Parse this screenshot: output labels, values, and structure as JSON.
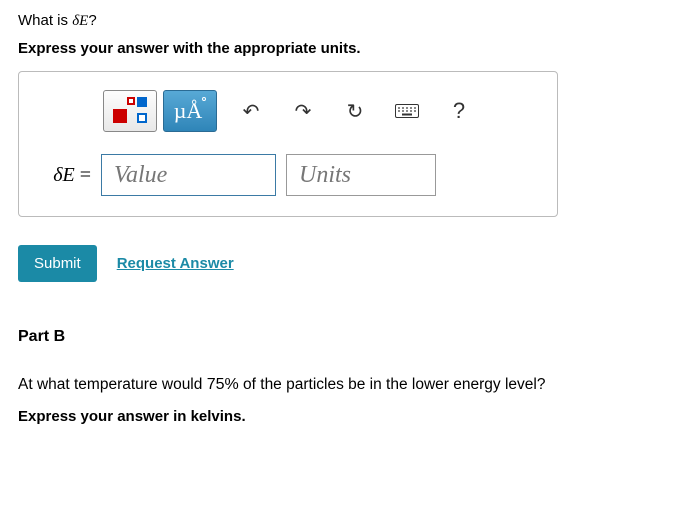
{
  "question": {
    "prefix": "What is ",
    "var": "δE",
    "suffix": "?"
  },
  "instruction": "Express your answer with the appropriate units.",
  "toolbar": {
    "mu_a": "µÅ",
    "undo": "↶",
    "redo": "↷",
    "reset": "↻",
    "help": "?"
  },
  "input": {
    "lhs_var": "δE",
    "lhs_eq": " = ",
    "value_placeholder": "Value",
    "units_placeholder": "Units"
  },
  "buttons": {
    "submit": "Submit",
    "request": "Request Answer"
  },
  "partB": {
    "heading": "Part B",
    "q_prefix": "At what temperature would ",
    "q_pct": "75%",
    "q_suffix": " of the particles be in the lower energy level?",
    "instruction": "Express your answer in kelvins."
  }
}
